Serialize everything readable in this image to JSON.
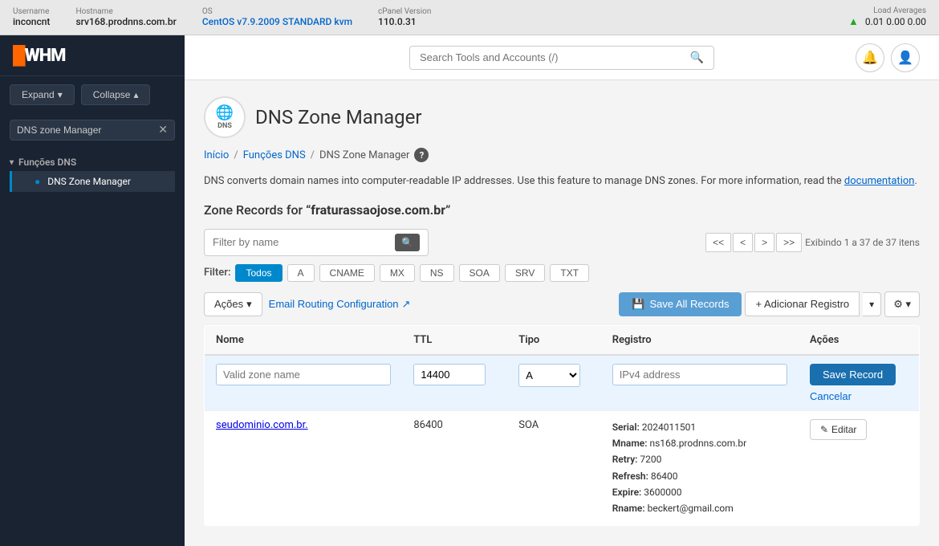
{
  "topbar": {
    "username_label": "Username",
    "username_value": "inconcnt",
    "hostname_label": "Hostname",
    "hostname_value": "srv168.prodnns.com.br",
    "os_label": "OS",
    "os_value": "CentOS v7.9.2009 STANDARD kvm",
    "cpanel_label": "cPanel Version",
    "cpanel_value": "110.0.31",
    "load_label": "Load Averages",
    "load_values": "0.01  0.00  0.00"
  },
  "sidebar": {
    "logo": "WHM",
    "expand_btn": "Expand",
    "collapse_btn": "Collapse",
    "search_placeholder": "DNS zone Manager",
    "section_label": "Funções DNS",
    "nav_item": "DNS Zone Manager"
  },
  "header": {
    "search_placeholder": "Search Tools and Accounts (/)"
  },
  "page": {
    "icon_label": "DNS",
    "title": "DNS Zone Manager",
    "breadcrumb_home": "Início",
    "breadcrumb_section": "Funções DNS",
    "breadcrumb_current": "DNS Zone Manager",
    "description": "DNS converts domain names into computer-readable IP addresses. Use this feature to manage DNS zones. For more information, read the",
    "description_link": "documentation",
    "zone_title_prefix": "Zone Records for “",
    "zone_domain": "fraturassaojose.com.br",
    "zone_title_suffix": "”"
  },
  "filter": {
    "search_placeholder": "Filter by name",
    "display_info": "Exibindo 1 a 37 de 37 itens",
    "tags": [
      "Todos",
      "A",
      "CNAME",
      "MX",
      "NS",
      "SOA",
      "SRV",
      "TXT"
    ],
    "active_tag": "Todos",
    "filter_label": "Filter:"
  },
  "pagination": {
    "first": "<<",
    "prev": "<",
    "next": ">",
    "last": ">>"
  },
  "actions": {
    "acoes_btn": "Ações",
    "email_routing_btn": "Email Routing Configuration",
    "save_all_btn": "Save All Records",
    "add_record_btn": "+ Adicionar Registro",
    "gear_icon": "⚙"
  },
  "table": {
    "headers": [
      "Nome",
      "TTL",
      "Tipo",
      "Registro",
      "Ações"
    ],
    "new_row": {
      "name_placeholder": "Valid zone name",
      "ttl_value": "14400",
      "type_value": "A",
      "registro_placeholder": "IPv4 address",
      "save_btn": "Save Record",
      "cancel_btn": "Cancelar"
    },
    "rows": [
      {
        "name": "seudominio.com.br.",
        "ttl": "86400",
        "tipo": "SOA",
        "registro": "Serial: 2024011501\nMname: ns168.prodnns.com.br\nRetry: 7200\nRefresh: 86400\nExpire: 3600000\nRname: beckert@gmail.com",
        "acoes": "✎ Editar"
      }
    ]
  }
}
